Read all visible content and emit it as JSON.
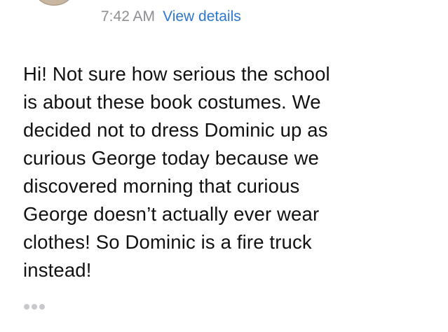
{
  "message": {
    "time": "7:42 AM",
    "view_details_label": "View details",
    "body": "Hi! Not sure how serious the school\nis about these book costumes. We\ndecided not to dress Dominic up as\ncurious George today because we\ndiscovered morning that curious\nGeorge doesn’t actually ever wear\nclothes! So Dominic is a fire truck\ninstead!",
    "more_icon": "ellipsis-icon"
  },
  "colors": {
    "link": "#2d76d2",
    "timestamp": "#8e8e93",
    "text": "#111111",
    "dots": "#c7c7cc"
  }
}
